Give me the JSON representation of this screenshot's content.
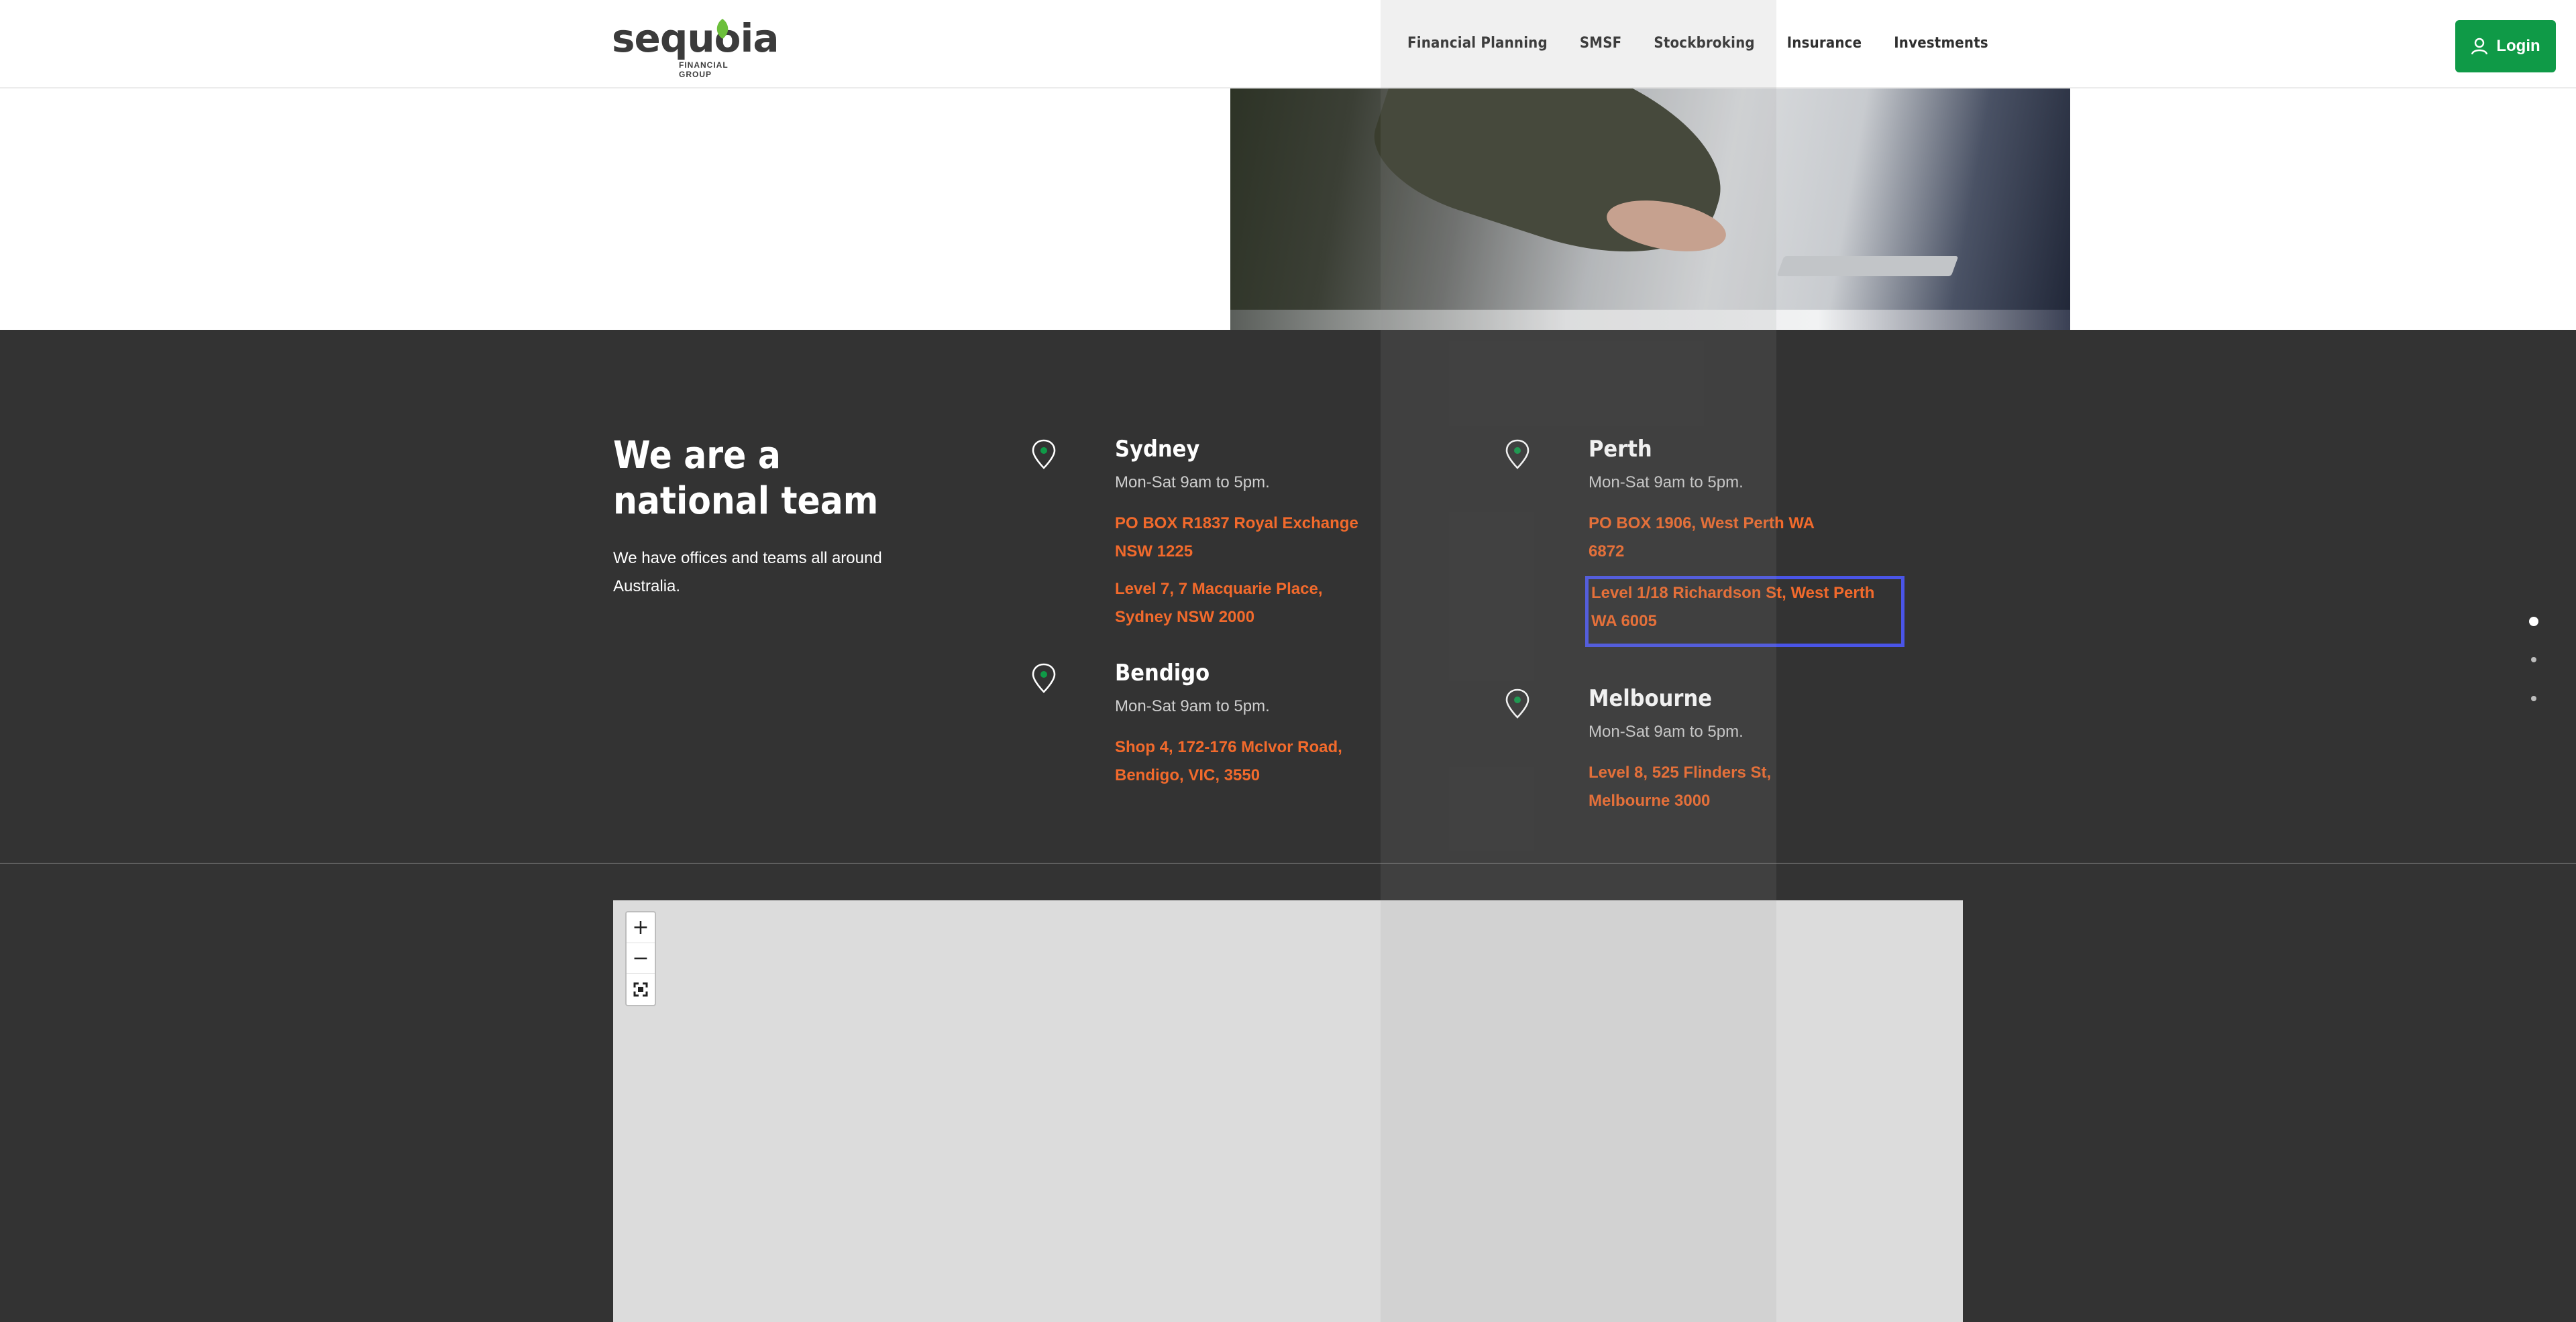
{
  "header": {
    "logo_text": "sequoia",
    "logo_subtext": "FINANCIAL GROUP",
    "nav": [
      "Financial Planning",
      "SMSF",
      "Stockbroking",
      "Insurance",
      "Investments"
    ],
    "login_label": "Login",
    "login_color": "#0f9a47"
  },
  "intro": {
    "title": "We are a national team",
    "text": "We have offices and teams all around Australia."
  },
  "offices": {
    "sydney": {
      "name": "Sydney",
      "hours": "Mon-Sat 9am to 5pm.",
      "addresses": [
        "PO BOX R1837 Royal Exchange NSW 1225",
        "Level 7, 7 Macquarie Place, Sydney NSW 2000"
      ]
    },
    "perth": {
      "name": "Perth",
      "hours": "Mon-Sat 9am to 5pm.",
      "addresses": [
        "PO BOX 1906, West Perth WA 6872",
        "Level 1/18 Richardson St, West Perth WA 6005"
      ]
    },
    "bendigo": {
      "name": "Bendigo",
      "hours": "Mon-Sat 9am to 5pm.",
      "addresses": [
        "Shop 4, 172-176 McIvor Road, Bendigo, VIC, 3550"
      ]
    },
    "melbourne": {
      "name": "Melbourne",
      "hours": "Mon-Sat 9am to 5pm.",
      "addresses": [
        "Level 8, 525 Flinders St, Melbourne 3000"
      ]
    }
  },
  "map": {
    "zoom_in": "+",
    "zoom_out": "−",
    "fullscreen_icon": "fullscreen-icon"
  },
  "colors": {
    "accent_orange": "#f26a2c",
    "dark_bg": "#333333",
    "focus_outline": "#4a55e8"
  },
  "slider": {
    "count": 3,
    "active_index": 0
  }
}
